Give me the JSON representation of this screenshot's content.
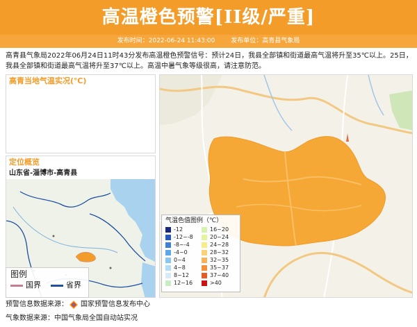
{
  "header": {
    "title": "高温橙色预警[II级/严重]",
    "publish_time": "发布时间：2022-06-24 11:43:00",
    "publisher": "发布单位：高青县气象局"
  },
  "description": "高青县气象局2022年06月24日11时43分发布高温橙色预警信号：预计24日，我县全部镇和街道最高气温将升至35℃以上。25日，我县全部镇和街道最高气温将升至37℃以上。高温中暑气象等级很高，请注意防范。",
  "temperature_panel": {
    "title": "高青当地气温实况(℃)"
  },
  "location_panel": {
    "title": "定位概览",
    "path": "山东省-淄博市-高青县"
  },
  "map_legend": {
    "title": "图例",
    "items": [
      {
        "label": "国界",
        "color": "#c77b8e"
      },
      {
        "label": "省界",
        "color": "#1f4fa0"
      }
    ]
  },
  "color_legend": {
    "title": "气温色值图例（℃）",
    "items": [
      {
        "label": "-12",
        "color": "#1a2a7a"
      },
      {
        "label": "16~20",
        "color": "#d6f2b0"
      },
      {
        "label": "-12~-8",
        "color": "#2559b5"
      },
      {
        "label": "20~24",
        "color": "#e5f3a0"
      },
      {
        "label": "-8~-4",
        "color": "#3d80d4"
      },
      {
        "label": "24~28",
        "color": "#f7ec8b"
      },
      {
        "label": "-4~0",
        "color": "#5ea6e8"
      },
      {
        "label": "28~32",
        "color": "#f8d37a"
      },
      {
        "label": "0~4",
        "color": "#8ac6f2"
      },
      {
        "label": "32~35",
        "color": "#f8b45a"
      },
      {
        "label": "4~8",
        "color": "#b4dcf6"
      },
      {
        "label": "35~37",
        "color": "#f3903c"
      },
      {
        "label": "8~12",
        "color": "#d5ecf8"
      },
      {
        "label": "37~40",
        "color": "#e65a26"
      },
      {
        "label": "12~16",
        "color": "#c9ecc4"
      },
      {
        "label": ">40",
        "color": "#c71414"
      }
    ]
  },
  "footer": {
    "source_label": "预警信息数据来源：",
    "source_name": "国家预警信息发布中心",
    "weather_source": "气象数据来源：中国气象局全国自动站实况"
  },
  "colors": {
    "banner": "#f39c29",
    "warning_area": "#f6a836"
  }
}
